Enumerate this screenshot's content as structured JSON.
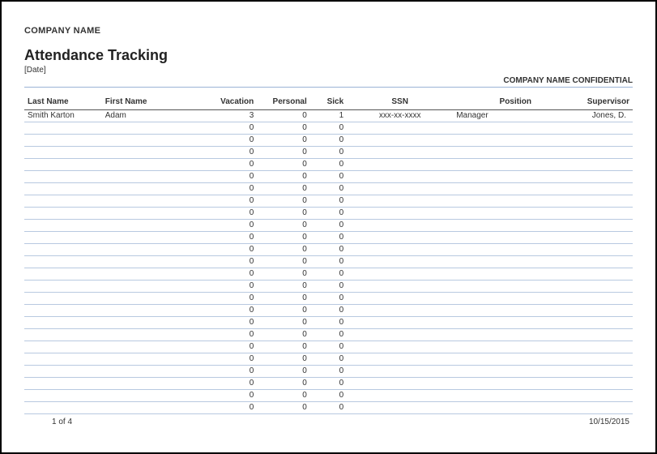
{
  "header": {
    "company": "COMPANY NAME",
    "title": "Attendance Tracking",
    "date_placeholder": "[Date]",
    "confidential": "COMPANY NAME CONFIDENTIAL"
  },
  "columns": {
    "last_name": "Last Name",
    "first_name": "First Name",
    "vacation": "Vacation",
    "personal": "Personal",
    "sick": "Sick",
    "ssn": "SSN",
    "position": "Position",
    "supervisor": "Supervisor"
  },
  "rows": [
    {
      "last_name": "Smith Karton",
      "first_name": "Adam",
      "vacation": "3",
      "personal": "0",
      "sick": "1",
      "ssn": "xxx-xx-xxxx",
      "position": "Manager",
      "supervisor": "Jones, D."
    },
    {
      "last_name": "",
      "first_name": "",
      "vacation": "0",
      "personal": "0",
      "sick": "0",
      "ssn": "",
      "position": "",
      "supervisor": ""
    },
    {
      "last_name": "",
      "first_name": "",
      "vacation": "0",
      "personal": "0",
      "sick": "0",
      "ssn": "",
      "position": "",
      "supervisor": ""
    },
    {
      "last_name": "",
      "first_name": "",
      "vacation": "0",
      "personal": "0",
      "sick": "0",
      "ssn": "",
      "position": "",
      "supervisor": ""
    },
    {
      "last_name": "",
      "first_name": "",
      "vacation": "0",
      "personal": "0",
      "sick": "0",
      "ssn": "",
      "position": "",
      "supervisor": ""
    },
    {
      "last_name": "",
      "first_name": "",
      "vacation": "0",
      "personal": "0",
      "sick": "0",
      "ssn": "",
      "position": "",
      "supervisor": ""
    },
    {
      "last_name": "",
      "first_name": "",
      "vacation": "0",
      "personal": "0",
      "sick": "0",
      "ssn": "",
      "position": "",
      "supervisor": ""
    },
    {
      "last_name": "",
      "first_name": "",
      "vacation": "0",
      "personal": "0",
      "sick": "0",
      "ssn": "",
      "position": "",
      "supervisor": ""
    },
    {
      "last_name": "",
      "first_name": "",
      "vacation": "0",
      "personal": "0",
      "sick": "0",
      "ssn": "",
      "position": "",
      "supervisor": ""
    },
    {
      "last_name": "",
      "first_name": "",
      "vacation": "0",
      "personal": "0",
      "sick": "0",
      "ssn": "",
      "position": "",
      "supervisor": ""
    },
    {
      "last_name": "",
      "first_name": "",
      "vacation": "0",
      "personal": "0",
      "sick": "0",
      "ssn": "",
      "position": "",
      "supervisor": ""
    },
    {
      "last_name": "",
      "first_name": "",
      "vacation": "0",
      "personal": "0",
      "sick": "0",
      "ssn": "",
      "position": "",
      "supervisor": ""
    },
    {
      "last_name": "",
      "first_name": "",
      "vacation": "0",
      "personal": "0",
      "sick": "0",
      "ssn": "",
      "position": "",
      "supervisor": ""
    },
    {
      "last_name": "",
      "first_name": "",
      "vacation": "0",
      "personal": "0",
      "sick": "0",
      "ssn": "",
      "position": "",
      "supervisor": ""
    },
    {
      "last_name": "",
      "first_name": "",
      "vacation": "0",
      "personal": "0",
      "sick": "0",
      "ssn": "",
      "position": "",
      "supervisor": ""
    },
    {
      "last_name": "",
      "first_name": "",
      "vacation": "0",
      "personal": "0",
      "sick": "0",
      "ssn": "",
      "position": "",
      "supervisor": ""
    },
    {
      "last_name": "",
      "first_name": "",
      "vacation": "0",
      "personal": "0",
      "sick": "0",
      "ssn": "",
      "position": "",
      "supervisor": ""
    },
    {
      "last_name": "",
      "first_name": "",
      "vacation": "0",
      "personal": "0",
      "sick": "0",
      "ssn": "",
      "position": "",
      "supervisor": ""
    },
    {
      "last_name": "",
      "first_name": "",
      "vacation": "0",
      "personal": "0",
      "sick": "0",
      "ssn": "",
      "position": "",
      "supervisor": ""
    },
    {
      "last_name": "",
      "first_name": "",
      "vacation": "0",
      "personal": "0",
      "sick": "0",
      "ssn": "",
      "position": "",
      "supervisor": ""
    },
    {
      "last_name": "",
      "first_name": "",
      "vacation": "0",
      "personal": "0",
      "sick": "0",
      "ssn": "",
      "position": "",
      "supervisor": ""
    },
    {
      "last_name": "",
      "first_name": "",
      "vacation": "0",
      "personal": "0",
      "sick": "0",
      "ssn": "",
      "position": "",
      "supervisor": ""
    },
    {
      "last_name": "",
      "first_name": "",
      "vacation": "0",
      "personal": "0",
      "sick": "0",
      "ssn": "",
      "position": "",
      "supervisor": ""
    },
    {
      "last_name": "",
      "first_name": "",
      "vacation": "0",
      "personal": "0",
      "sick": "0",
      "ssn": "",
      "position": "",
      "supervisor": ""
    },
    {
      "last_name": "",
      "first_name": "",
      "vacation": "0",
      "personal": "0",
      "sick": "0",
      "ssn": "",
      "position": "",
      "supervisor": ""
    }
  ],
  "footer": {
    "page_indicator": "1 of 4",
    "footer_date": "10/15/2015"
  }
}
